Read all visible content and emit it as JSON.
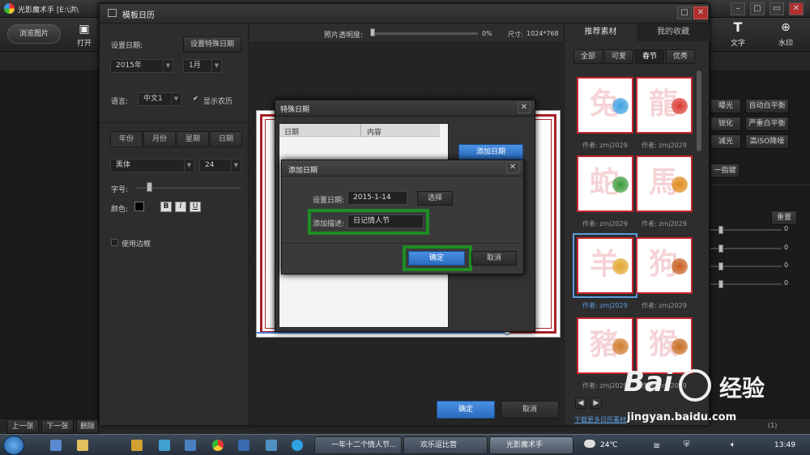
{
  "app": {
    "title": "光影魔术手  [E:\\洪\\",
    "toolbar": {
      "browse": "浏览图片",
      "open": "打开",
      "text": "文字",
      "watermark": "水印"
    },
    "right_panel": {
      "buttons": [
        "曝光",
        "自动白平衡",
        "锐化",
        "严重白平衡",
        "减光",
        "高ISO降噪",
        "一指键"
      ],
      "reset": "重置",
      "slider_values": [
        "0",
        "0",
        "0",
        "0"
      ]
    },
    "bottom": {
      "prev": "上一张",
      "next": "下一张",
      "delete": "删除",
      "right_label": "(1)"
    }
  },
  "template_window": {
    "title": "模板日历",
    "left": {
      "set_date_label": "设置日期:",
      "special_date_button": "设置特殊日期",
      "year": "2015年",
      "month": "1月",
      "language_label": "语言:",
      "language": "中文1",
      "lunar_label": "显示农历",
      "lunar_checked": true,
      "segments": [
        "年份",
        "月份",
        "星期",
        "日期"
      ],
      "font": "黑体",
      "font_size": "24",
      "size_label": "字号:",
      "color_label": "颜色:",
      "bold": "B",
      "italic": "I",
      "underline": "U",
      "border_label": "使用边框"
    },
    "center": {
      "opacity_label": "照片透明度:",
      "opacity_value": "0%",
      "size_label": "尺寸:",
      "size_value": "1024*768",
      "ok": "确定",
      "cancel": "取消"
    },
    "right": {
      "tabs": [
        "推荐素材",
        "我的收藏"
      ],
      "filters": [
        "全部",
        "可爱",
        "春节",
        "优秀"
      ],
      "active_filter": "春节",
      "thumbs": [
        {
          "char": "兔",
          "author": "作者: zmj2029",
          "color": "#3aa0e0"
        },
        {
          "char": "龍",
          "author": "作者: zmj2029",
          "color": "#d9362c"
        },
        {
          "char": "蛇",
          "author": "作者: zmj2029",
          "color": "#3a9a3a"
        },
        {
          "char": "馬",
          "author": "作者: zmj2029",
          "color": "#e08a1c"
        },
        {
          "char": "羊",
          "author": "作者: zmj2029",
          "color": "#e0a62c"
        },
        {
          "char": "狗",
          "author": "作者: zmj2029",
          "color": "#c85c1c"
        },
        {
          "char": "豬",
          "author": "作者: zmj2029",
          "color": "#d07a2c"
        },
        {
          "char": "猴",
          "author": "作者: zmj2029",
          "color": "#c86a20"
        }
      ],
      "download_link": "下载更多日历素材"
    }
  },
  "special_dialog": {
    "title": "特殊日期",
    "col_date": "日期",
    "col_content": "内容",
    "add_button": "添加日期"
  },
  "add_dialog": {
    "title": "添加日期",
    "date_label": "设置日期:",
    "date_value": "2015-1-14",
    "choose": "选择",
    "desc_label": "添加描述:",
    "desc_value": "日记情人节",
    "ok": "确定",
    "cancel": "取消"
  },
  "taskbar": {
    "tasks": [
      "一年十二个情人节...",
      "欢乐逗比营",
      "光影魔术手"
    ],
    "weather": "24℃",
    "time": "13:49"
  },
  "watermark": {
    "text": "Bai",
    "text2": "经验",
    "url": "jingyan.baidu.com"
  }
}
